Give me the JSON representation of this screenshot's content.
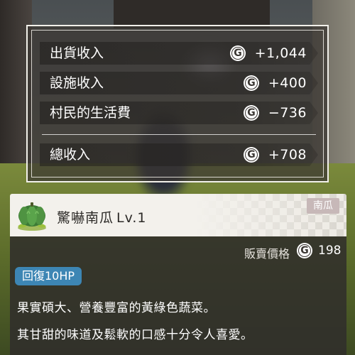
{
  "income_summary": {
    "rows": [
      {
        "label": "出貨收入",
        "currency_icon": "G",
        "amount": "+1,044"
      },
      {
        "label": "設施收入",
        "currency_icon": "G",
        "amount": "+400"
      },
      {
        "label": "村民的生活費",
        "currency_icon": "G",
        "amount": "−736"
      }
    ],
    "total": {
      "label": "總收入",
      "currency_icon": "G",
      "amount": "+708"
    }
  },
  "item": {
    "name": "驚嚇南瓜",
    "level": "Lv.1",
    "category": "南瓜",
    "price_label": "販賣價格",
    "price_icon": "G",
    "price": "198",
    "effect": "回復10HP",
    "description": [
      "果實碩大、營養豐富的黃綠色蔬菜。",
      "其甘甜的味道及鬆軟的口感十分令人喜愛。"
    ],
    "icon": "green-pumpkin-icon"
  },
  "colors": {
    "panel_border": "#f2f0ea",
    "effect_tag": "#3d86b4",
    "category_tag": "#c7b8b8",
    "card_header": "#f3f1ec"
  }
}
